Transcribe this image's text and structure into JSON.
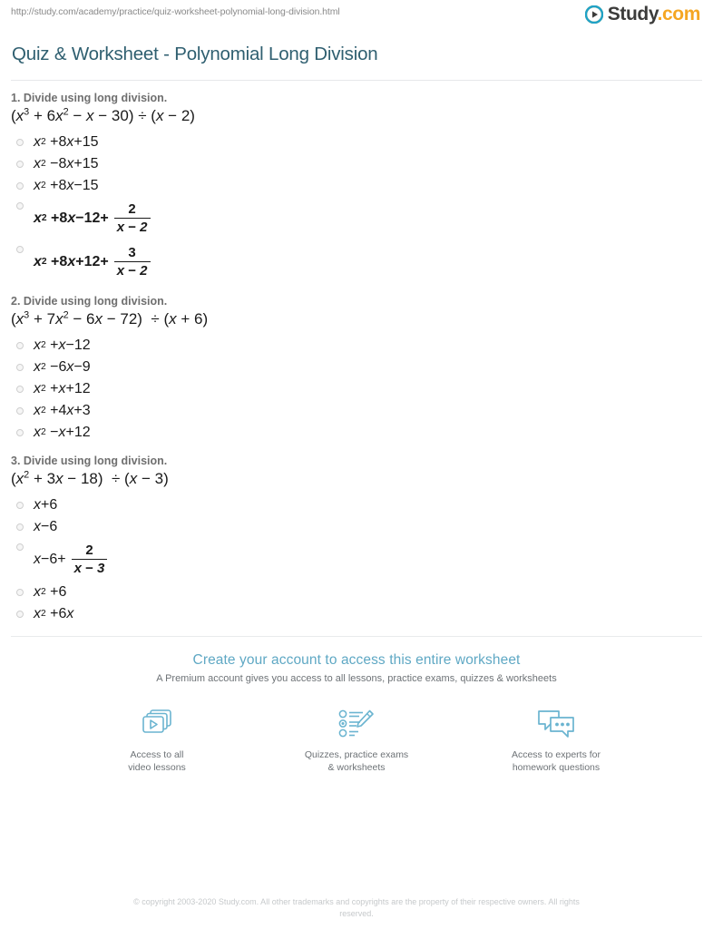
{
  "header": {
    "url": "http://study.com/academy/practice/quiz-worksheet-polynomial-long-division.html",
    "brand_name": "Study",
    "brand_suffix": ".com",
    "brand_accent_color": "#f5a623",
    "brand_icon": "play-circle-icon"
  },
  "title": "Quiz & Worksheet - Polynomial Long Division",
  "title_color": "#2f5f70",
  "questions": [
    {
      "number": "1.",
      "prompt": "1. Divide using long division.",
      "expression": "(x^3 + 6x^2 − x − 30) ÷ (x − 2)",
      "options": [
        {
          "text": "x^2 + 8x + 15",
          "has_fraction": false
        },
        {
          "text": "x^2 − 8x + 15",
          "has_fraction": false
        },
        {
          "text": "x^2 + 8x − 15",
          "has_fraction": false
        },
        {
          "text": "x^2 + 8x − 12 + 2/(x − 2)",
          "has_fraction": true,
          "lead": "x^2 + 8x − 12 +",
          "numerator": "2",
          "denominator": "x − 2"
        },
        {
          "text": "x^2 + 8x + 12 + 3/(x − 2)",
          "has_fraction": true,
          "lead": "x^2 + 8x + 12 +",
          "numerator": "3",
          "denominator": "x − 2"
        }
      ]
    },
    {
      "number": "2.",
      "prompt": "2. Divide using long division.",
      "expression": "(x^3 + 7x^2 − 6x − 72)  ÷ (x + 6)",
      "options": [
        {
          "text": "x^2 + x − 12",
          "has_fraction": false
        },
        {
          "text": "x^2 − 6x − 9",
          "has_fraction": false
        },
        {
          "text": "x^2 + x + 12",
          "has_fraction": false
        },
        {
          "text": "x^2 + 4x + 3",
          "has_fraction": false
        },
        {
          "text": "x^2 − x + 12",
          "has_fraction": false
        }
      ]
    },
    {
      "number": "3.",
      "prompt": "3. Divide using long division.",
      "expression": "(x^2 + 3x − 18)  ÷ (x − 3)",
      "options": [
        {
          "text": "x + 6",
          "has_fraction": false
        },
        {
          "text": "x − 6",
          "has_fraction": false
        },
        {
          "text": "x − 6 + 2/(x − 3)",
          "has_fraction": true,
          "lead": "x − 6 +",
          "numerator": "2",
          "denominator": "x − 3"
        },
        {
          "text": "x^2 + 6",
          "has_fraction": false
        },
        {
          "text": "x^2 + 6x",
          "has_fraction": false
        }
      ]
    }
  ],
  "cta": {
    "headline": "Create your account to access this entire worksheet",
    "subline": "A Premium account gives you access to all lessons, practice exams, quizzes & worksheets",
    "headline_color": "#5fa8c4"
  },
  "benefits": [
    {
      "icon": "video-lessons-icon",
      "label": "Access to all\nvideo lessons"
    },
    {
      "icon": "quiz-worksheet-icon",
      "label": "Quizzes, practice exams\n& worksheets"
    },
    {
      "icon": "expert-chat-icon",
      "label": "Access to experts for\nhomework questions"
    }
  ],
  "copyright": "© copyright 2003-2020 Study.com. All other trademarks and copyrights are the property of their respective owners. All rights reserved."
}
